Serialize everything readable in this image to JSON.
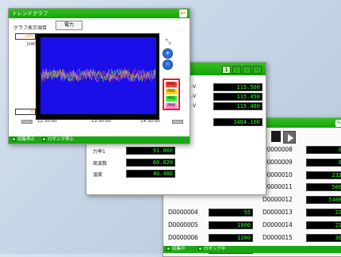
{
  "win3": {
    "values_left": [
      "",
      "",
      "",
      "",
      "",
      "55",
      "1000",
      "1200",
      "20"
    ],
    "ids_left": [
      "",
      "",
      "",
      "",
      "",
      "D0000004",
      "D0000005",
      "D0000006",
      "D0000007"
    ],
    "ids_right": [
      "D0000008",
      "D0000009",
      "D0000010",
      "D0000011",
      "D0000012",
      "D0000013",
      "D0000014",
      "D0000015"
    ],
    "values_right": [
      "0",
      "0",
      "232",
      "500",
      "5408",
      "22",
      "21",
      "30"
    ],
    "status_collect": "収集中",
    "status_logging": "ロギング中"
  },
  "win2": {
    "pager": [
      "1",
      "2",
      "3",
      "4"
    ],
    "right_values": [
      "115.500",
      "115.450",
      "115.480",
      "3464.100"
    ],
    "right_labels": [
      "-Ⅴ",
      "-Ⅴ",
      "-Ⅴ"
    ],
    "left_labels": [
      "力率1",
      "周波数",
      "温度"
    ],
    "left_values": [
      "91.000",
      "60.020",
      "40.400"
    ]
  },
  "win1": {
    "title": "トレンドグラフ",
    "display_label": "グラフ表示項目",
    "display_value": "電力",
    "y_max": "500",
    "y_unit": "[kW]",
    "y_min": "0",
    "x_ticks": [
      "12:30:00",
      "13:30:00",
      "14:30:00"
    ],
    "legend": [
      {
        "label": "PM1",
        "color": "#ff3a3a"
      },
      {
        "label": "PM2",
        "color": "#ffd400"
      },
      {
        "label": "PM3",
        "color": "#3cf03c"
      },
      {
        "label": "PM4",
        "color": "#ff8ad8"
      }
    ],
    "status_stop_collect": "収集停止",
    "status_stop_logging": "ロギング停止"
  }
}
